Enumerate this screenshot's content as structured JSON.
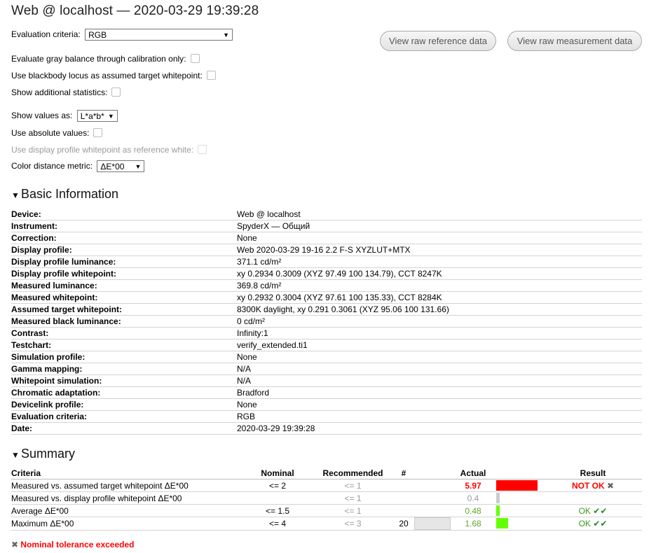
{
  "header": {
    "title": "Web @ localhost — 2020-03-29 19:39:28"
  },
  "options": {
    "evaluation_criteria_label": "Evaluation criteria:",
    "evaluation_criteria_value": "RGB",
    "gray_balance_label": "Evaluate gray balance through calibration only:",
    "blackbody_label": "Use blackbody locus as assumed target whitepoint:",
    "additional_stats_label": "Show additional statistics:",
    "show_values_label": "Show values as:",
    "show_values_value": "L*a*b*",
    "absolute_values_label": "Use absolute values:",
    "display_profile_wp_label": "Use display profile whitepoint as reference white:",
    "color_distance_label": "Color distance metric:",
    "color_distance_value": "ΔE*00"
  },
  "buttons": {
    "raw_reference": "View raw reference data",
    "raw_measurement": "View raw measurement data"
  },
  "basic_info": {
    "heading": "Basic Information",
    "rows": [
      {
        "key": "Device:",
        "value": "Web @ localhost"
      },
      {
        "key": "Instrument:",
        "value": "SpyderX — Общий"
      },
      {
        "key": "Correction:",
        "value": "None"
      },
      {
        "key": "Display profile:",
        "value": "Web 2020-03-29 19-16 2.2 F-S XYZLUT+MTX"
      },
      {
        "key": "Display profile luminance:",
        "value": "371.1 cd/m²"
      },
      {
        "key": "Display profile whitepoint:",
        "value": "xy 0.2934 0.3009 (XYZ 97.49 100 134.79), CCT 8247K"
      },
      {
        "key": "Measured luminance:",
        "value": "369.8 cd/m²"
      },
      {
        "key": "Measured whitepoint:",
        "value": "xy 0.2932 0.3004 (XYZ 97.61 100 135.33), CCT 8284K"
      },
      {
        "key": "Assumed target whitepoint:",
        "value": "8300K daylight, xy 0.291 0.3061 (XYZ 95.06 100 131.66)"
      },
      {
        "key": "Measured black luminance:",
        "value": "0 cd/m²"
      },
      {
        "key": "Contrast:",
        "value": "Infinity:1"
      },
      {
        "key": "Testchart:",
        "value": "verify_extended.ti1"
      },
      {
        "key": "Simulation profile:",
        "value": "None"
      },
      {
        "key": "Gamma mapping:",
        "value": "N/A"
      },
      {
        "key": "Whitepoint simulation:",
        "value": "N/A"
      },
      {
        "key": "Chromatic adaptation:",
        "value": "Bradford"
      },
      {
        "key": "Devicelink profile:",
        "value": "None"
      },
      {
        "key": "Evaluation criteria:",
        "value": "RGB"
      },
      {
        "key": "Date:",
        "value": "2020-03-29 19:39:28"
      }
    ]
  },
  "summary": {
    "heading": "Summary",
    "columns": {
      "criteria": "Criteria",
      "nominal": "Nominal",
      "recommended": "Recommended",
      "count": "#",
      "actual": "Actual",
      "result": "Result"
    },
    "rows": [
      {
        "criteria": "Measured vs. assumed target whitepoint ΔE*00",
        "nominal": "<= 2",
        "recommended": "<= 1",
        "count": "",
        "actual": "5.97",
        "result": "NOT OK",
        "status": "fail",
        "bar_fraction": 0.9,
        "bar_color": "#ff0000"
      },
      {
        "criteria": "Measured vs. display profile whitepoint ΔE*00",
        "nominal": "",
        "recommended": "<= 1",
        "count": "",
        "actual": "0.4",
        "result": "",
        "status": "neutral",
        "bar_fraction": 0.08,
        "bar_color": "#cccccc"
      },
      {
        "criteria": "Average ΔE*00",
        "nominal": "<= 1.5",
        "recommended": "<= 1",
        "count": "",
        "actual": "0.48",
        "result": "OK",
        "status": "ok",
        "bar_fraction": 0.07,
        "bar_color": "#66ff00"
      },
      {
        "criteria": "Maximum ΔE*00",
        "nominal": "<= 4",
        "recommended": "<= 3",
        "count": "20",
        "actual": "1.68",
        "result": "OK",
        "status": "ok",
        "bar_fraction": 0.26,
        "bar_color": "#66ff00"
      }
    ]
  },
  "footer": {
    "message": "Nominal tolerance exceeded"
  }
}
